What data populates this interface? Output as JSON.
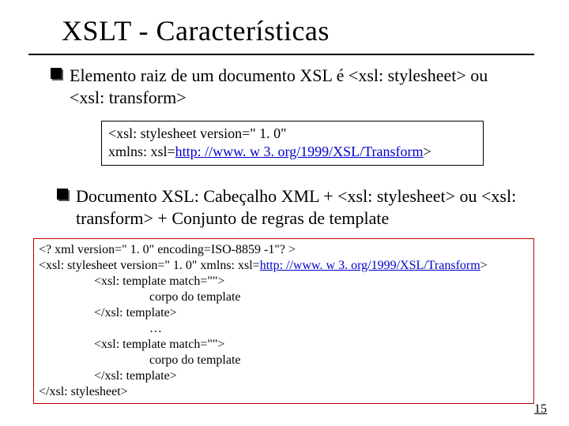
{
  "title": "XSLT - Características",
  "bullet1": "Elemento raiz de um documento XSL é <xsl: stylesheet> ou <xsl: transform>",
  "code1": {
    "line1_pre": "<xsl: stylesheet version=\" 1. 0\"",
    "line2_pre": "xmlns: xsl=",
    "line2_link": "http: //www. w 3. org/1999/XSL/Transform",
    "line2_post": ">"
  },
  "bullet2": "Documento XSL: Cabeçalho XML + <xsl: stylesheet> ou <xsl: transform> + Conjunto de regras de template",
  "code2": {
    "l1": "<? xml version=\" 1. 0\" encoding=ISO-8859 -1\"? >",
    "l2_pre": "<xsl: stylesheet version=\" 1. 0\"   xmlns: xsl=",
    "l2_link": "http: //www. w 3. org/1999/XSL/Transform",
    "l2_post": ">",
    "l3": "<xsl: template match=\"\">",
    "l4": "corpo do template",
    "l5": "</xsl: template>",
    "l6": "…",
    "l7": "<xsl: template match=\"\">",
    "l8": "corpo do template",
    "l9": "</xsl: template>",
    "l10": "</xsl: stylesheet>"
  },
  "pagenum": "15"
}
